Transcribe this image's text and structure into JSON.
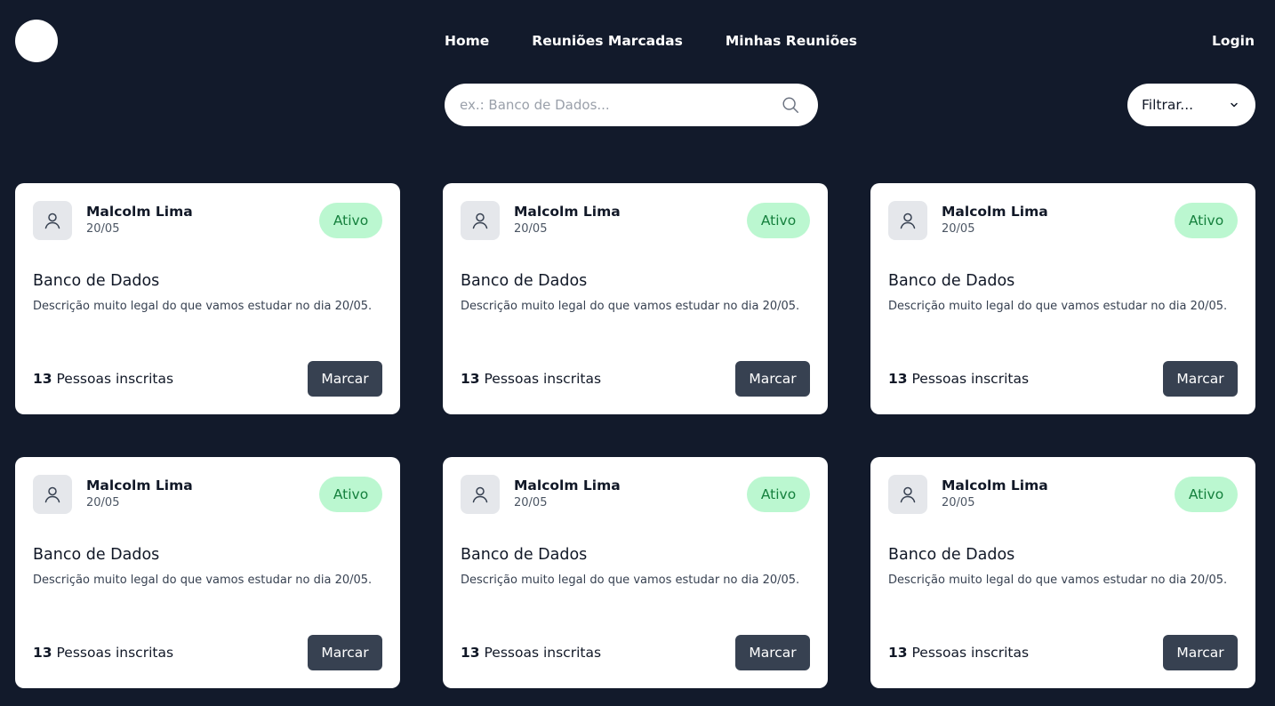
{
  "nav": {
    "items": [
      {
        "label": "Home"
      },
      {
        "label": "Reuniões Marcadas"
      },
      {
        "label": "Minhas Reuniões"
      }
    ],
    "login_label": "Login"
  },
  "search": {
    "placeholder": "ex.: Banco de Dados...",
    "value": "",
    "icon": "search-icon"
  },
  "filter": {
    "selected": "Filtrar...",
    "icon": "chevron-down-icon"
  },
  "colors": {
    "background": "#121a2b",
    "card": "#ffffff",
    "badge_bg": "#bbf7d0",
    "badge_text": "#15803d",
    "button": "#374151"
  },
  "cards": [
    {
      "author": "Malcolm Lima",
      "date": "20/05",
      "status": "Ativo",
      "title": "Banco de Dados",
      "description": "Descrição muito legal do que vamos estudar no dia 20/05.",
      "count": "13",
      "count_suffix": " Pessoas inscritas",
      "button": "Marcar"
    },
    {
      "author": "Malcolm Lima",
      "date": "20/05",
      "status": "Ativo",
      "title": "Banco de Dados",
      "description": "Descrição muito legal do que vamos estudar no dia 20/05.",
      "count": "13",
      "count_suffix": " Pessoas inscritas",
      "button": "Marcar"
    },
    {
      "author": "Malcolm Lima",
      "date": "20/05",
      "status": "Ativo",
      "title": "Banco de Dados",
      "description": "Descrição muito legal do que vamos estudar no dia 20/05.",
      "count": "13",
      "count_suffix": " Pessoas inscritas",
      "button": "Marcar"
    },
    {
      "author": "Malcolm Lima",
      "date": "20/05",
      "status": "Ativo",
      "title": "Banco de Dados",
      "description": "Descrição muito legal do que vamos estudar no dia 20/05.",
      "count": "13",
      "count_suffix": " Pessoas inscritas",
      "button": "Marcar"
    },
    {
      "author": "Malcolm Lima",
      "date": "20/05",
      "status": "Ativo",
      "title": "Banco de Dados",
      "description": "Descrição muito legal do que vamos estudar no dia 20/05.",
      "count": "13",
      "count_suffix": " Pessoas inscritas",
      "button": "Marcar"
    },
    {
      "author": "Malcolm Lima",
      "date": "20/05",
      "status": "Ativo",
      "title": "Banco de Dados",
      "description": "Descrição muito legal do que vamos estudar no dia 20/05.",
      "count": "13",
      "count_suffix": " Pessoas inscritas",
      "button": "Marcar"
    }
  ]
}
